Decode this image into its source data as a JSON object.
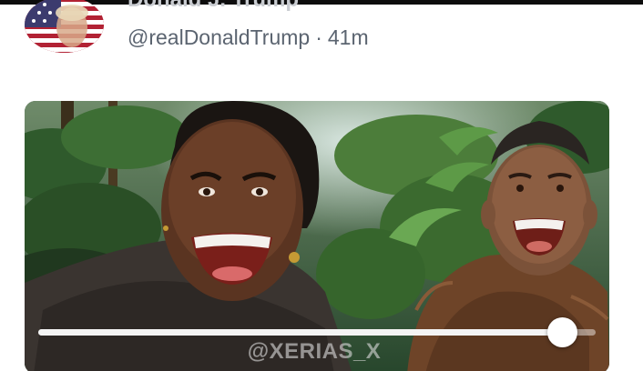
{
  "post": {
    "display_name": "Donald J. Trump",
    "handle": "@realDonaldTrump",
    "separator": "·",
    "time_ago": "41m",
    "avatar_icon": "flag-profile-avatar"
  },
  "media": {
    "type": "video",
    "watermark": "@XERIAS_X",
    "progress": 0.94
  },
  "colors": {
    "handle_text": "#5b6470",
    "scrubber": "#ffffff",
    "top_bar": "#0d0d0d"
  }
}
